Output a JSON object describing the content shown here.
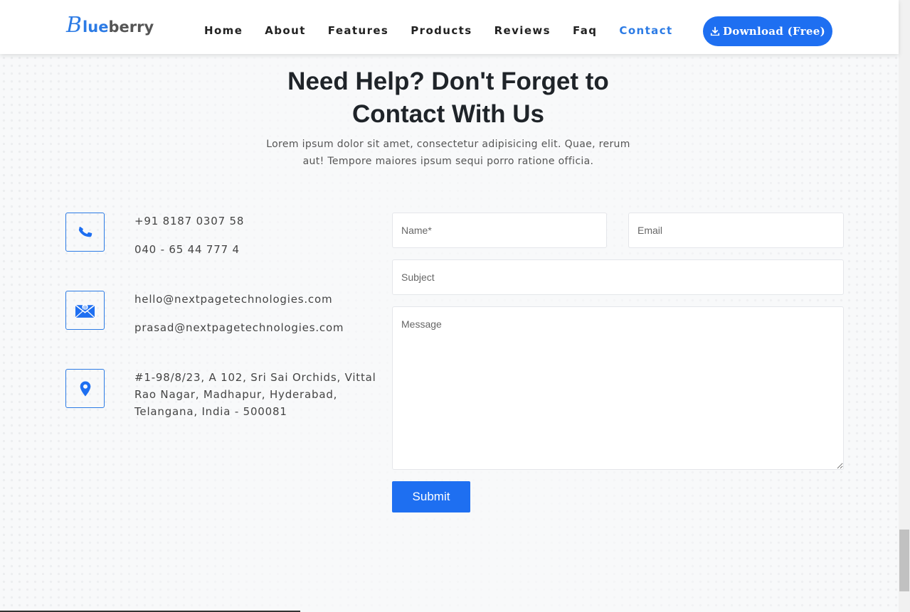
{
  "header": {
    "logo": {
      "first": "B",
      "highlight": "lue",
      "rest": "berry"
    },
    "nav": [
      "Home",
      "About",
      "Features",
      "Products",
      "Reviews",
      "Faq",
      "Contact"
    ],
    "active_nav": "Contact",
    "download_label": "Download (Free)"
  },
  "section": {
    "title_line1": "Need Help? Don't Forget to",
    "title_line2": "Contact With Us",
    "subtitle_line1": "Lorem ipsum dolor sit amet, consectetur adipisicing elit. Quae, rerum",
    "subtitle_line2": "aut! Tempore maiores ipsum sequi porro ratione officia."
  },
  "contact_info": {
    "phone_1": "+91 8187 0307 58",
    "phone_2": "040 - 65 44 777 4",
    "email_1": "hello@nextpagetechnologies.com",
    "email_2": "prasad@nextpagetechnologies.com",
    "address_line1": "#1-98/8/23, A 102, Sri Sai Orchids, Vittal",
    "address_line2": "Rao Nagar, Madhapur, Hyderabad,",
    "address_line3": "Telangana, India - 500081"
  },
  "form": {
    "name_placeholder": "Name*",
    "email_placeholder": "Email",
    "subject_placeholder": "Subject",
    "message_placeholder": "Message",
    "submit_label": "Submit"
  },
  "colors": {
    "accent": "#1e6ff1",
    "link_active": "#2c7be5",
    "title": "#1f2429"
  },
  "icons": [
    "download-icon",
    "phone-icon",
    "envelope-icon",
    "map-pin-icon"
  ]
}
